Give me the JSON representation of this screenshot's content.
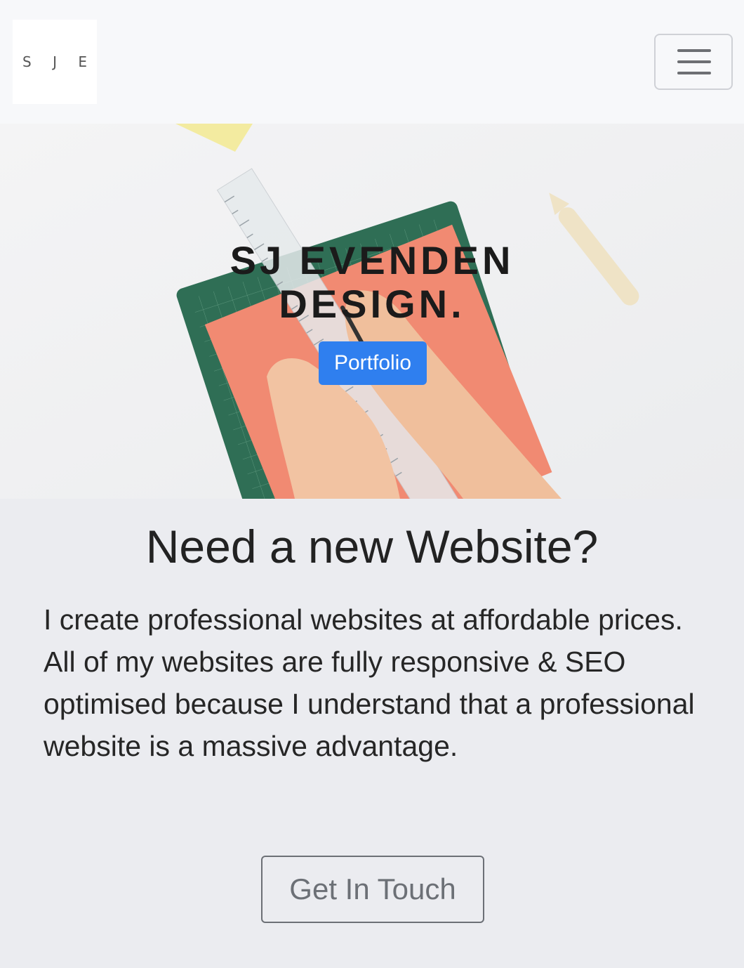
{
  "navbar": {
    "logo_text": "S J E",
    "menu_icon": "hamburger-menu-icon"
  },
  "hero": {
    "title_line1": "SJ EVENDEN",
    "title_line2": "DESIGN.",
    "button_label": "Portfolio",
    "button_color": "#2f7fef"
  },
  "content": {
    "heading": "Need a new Website?",
    "paragraph": "I create professional websites at affordable prices. All of my websites are fully responsive & SEO optimised because I understand that a professional website is a massive advantage.",
    "cta_label": "Get In Touch"
  }
}
